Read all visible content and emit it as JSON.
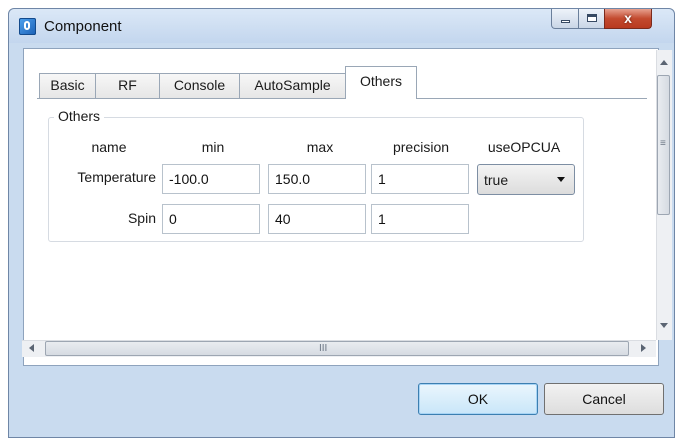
{
  "window": {
    "title": "Component",
    "controls": {
      "minimize": "",
      "maximize": "",
      "close_glyph": "x"
    }
  },
  "tabs": [
    {
      "label": "Basic",
      "active": false
    },
    {
      "label": "RF",
      "active": false
    },
    {
      "label": "Console",
      "active": false
    },
    {
      "label": "AutoSample",
      "active": false
    },
    {
      "label": "Others",
      "active": true
    }
  ],
  "group": {
    "title": "Others",
    "headers": {
      "name": "name",
      "min": "min",
      "max": "max",
      "precision": "precision",
      "useOPCUA": "useOPCUA"
    },
    "rows": [
      {
        "name": "Temperature",
        "min": "-100.0",
        "max": "150.0",
        "precision": "1",
        "useOPCUA": "true"
      },
      {
        "name": "Spin",
        "min": "0",
        "max": "40",
        "precision": "1"
      }
    ]
  },
  "scrollbars": {
    "grip_vertical": "≡",
    "grip_horizontal": "III"
  },
  "buttons": {
    "ok": "OK",
    "cancel": "Cancel"
  },
  "colors": {
    "ok_border": "#3c7fb1",
    "close_button": "#c34a2f",
    "window_frame": "#c9dbef"
  }
}
